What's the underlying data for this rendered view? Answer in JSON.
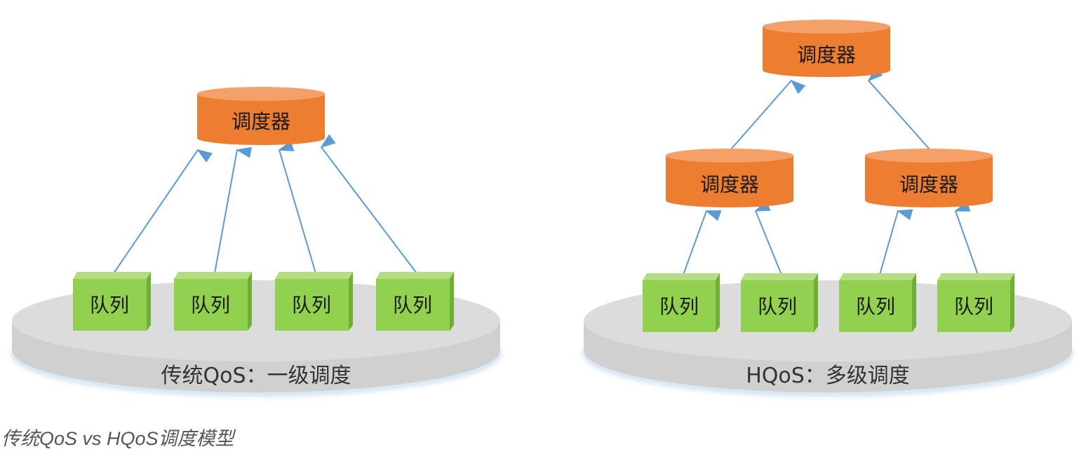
{
  "diagrams": [
    {
      "platform_label": "传统QoS：一级调度",
      "schedulers": [
        {
          "label": "调度器"
        }
      ],
      "queues": [
        {
          "label": "队列"
        },
        {
          "label": "队列"
        },
        {
          "label": "队列"
        },
        {
          "label": "队列"
        }
      ]
    },
    {
      "platform_label": "HQoS：多级调度",
      "schedulers": [
        {
          "label": "调度器"
        },
        {
          "label": "调度器"
        },
        {
          "label": "调度器"
        }
      ],
      "queues": [
        {
          "label": "队列"
        },
        {
          "label": "队列"
        },
        {
          "label": "队列"
        },
        {
          "label": "队列"
        }
      ]
    }
  ],
  "caption": "传统QoS vs HQoS调度模型",
  "colors": {
    "scheduler_fill": "#ED7D31",
    "queue_fill": "#92D050",
    "platform_fill": "#D9D9D9",
    "arrow": "#5B9BD5"
  }
}
